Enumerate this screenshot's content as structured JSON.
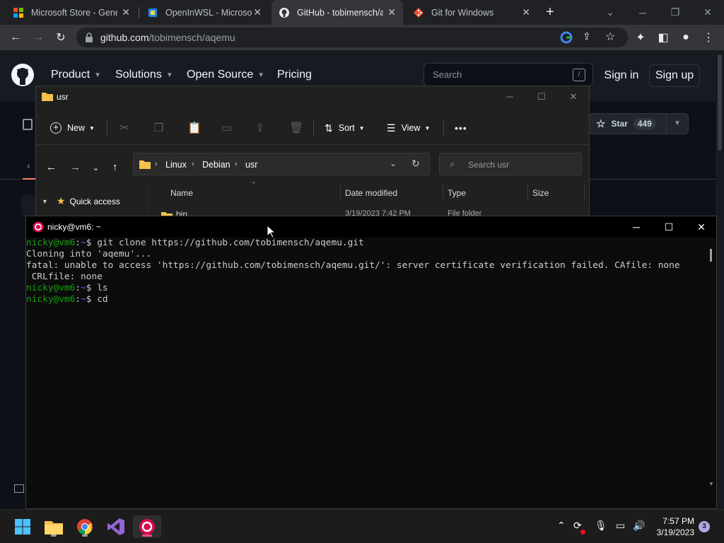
{
  "browser": {
    "tabs": [
      {
        "label": "Microsoft Store - Gene",
        "icon": "microsoft-store-icon"
      },
      {
        "label": "OpenInWSL - Microsoft",
        "icon": "openinwsl-icon"
      },
      {
        "label": "GitHub - tobimensch/a",
        "icon": "github-icon",
        "active": true
      },
      {
        "label": "Git for Windows",
        "icon": "git-icon"
      }
    ],
    "url_domain": "github.com",
    "url_path": "/tobimensch/aqemu"
  },
  "github": {
    "nav": [
      "Product",
      "Solutions",
      "Open Source",
      "Pricing"
    ],
    "search_placeholder": "Search",
    "search_shortcut": "/",
    "sign_in": "Sign in",
    "sign_up": "Sign up",
    "star_label": "Star",
    "star_count": "449"
  },
  "explorer": {
    "title": "usr",
    "commands": {
      "new": "New",
      "sort": "Sort",
      "view": "View",
      "more": "•••"
    },
    "breadcrumb": [
      "Linux",
      "Debian",
      "usr"
    ],
    "search_placeholder": "Search usr",
    "quick_access": "Quick access",
    "columns": [
      "Name",
      "Date modified",
      "Type",
      "Size"
    ],
    "partial_row": {
      "name": "bin",
      "date": "3/19/2023 7:42 PM",
      "type": "File folder"
    }
  },
  "terminal": {
    "title": "nicky@vm6: ~",
    "lines": [
      {
        "user": "nicky@vm6",
        "path": "~",
        "cmd": "git clone https://github.com/tobimensch/aqemu.git"
      },
      {
        "text": "Cloning into 'aqemu'..."
      },
      {
        "text": "fatal: unable to access 'https://github.com/tobimensch/aqemu.git/': server certificate verification failed. CAfile: none"
      },
      {
        "text": " CRLfile: none"
      },
      {
        "user": "nicky@vm6",
        "path": "~",
        "cmd": "ls"
      },
      {
        "user": "nicky@vm6",
        "path": "~",
        "cmd": "cd"
      }
    ]
  },
  "taskbar": {
    "apps": [
      "start-icon",
      "file-explorer-icon",
      "chrome-icon",
      "visual-studio-icon",
      "debian-icon"
    ],
    "time": "7:57 PM",
    "date": "3/19/2023",
    "notifications": "3"
  },
  "colors": {
    "prompt_user": "#13a10e",
    "prompt_path": "#3b78ff",
    "debian_red": "#d70a53"
  }
}
